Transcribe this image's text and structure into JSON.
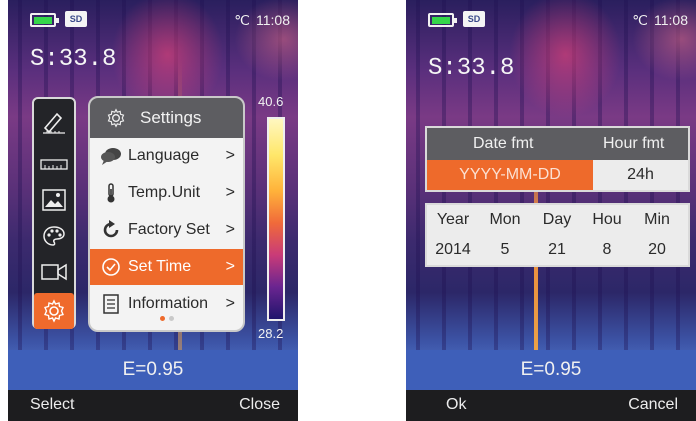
{
  "status": {
    "sd_label": "SD",
    "temp_unit": "℃",
    "time": "11:08"
  },
  "left_screen": {
    "spot": "S:33.8",
    "rail_icons": [
      "measure-pencil-icon",
      "ruler-icon",
      "image-gallery-icon",
      "palette-icon",
      "video-camera-icon",
      "gear-icon"
    ],
    "menu": {
      "title": "Settings",
      "items": [
        {
          "label": "Language",
          "arrow": ">",
          "icon": "speech-bubble-icon"
        },
        {
          "label": "Temp.Unit",
          "arrow": ">",
          "icon": "thermometer-icon"
        },
        {
          "label": "Factory Set",
          "arrow": ">",
          "icon": "reset-arrow-icon"
        },
        {
          "label": "Set Time",
          "arrow": ">",
          "icon": "clock-icon",
          "selected": true
        },
        {
          "label": "Information",
          "arrow": ">",
          "icon": "document-icon"
        }
      ],
      "page_index": 1,
      "page_count": 2
    },
    "scale": {
      "max": "40.6",
      "min": "28.2"
    },
    "emissivity": "E=0.95",
    "softkey_left": "Select",
    "softkey_right": "Close"
  },
  "right_screen": {
    "spot": "S:33.8",
    "date_fmt_header": "Date fmt",
    "hour_fmt_header": "Hour fmt",
    "date_fmt_value": "YYYY-MM-DD",
    "hour_fmt_value": "24h",
    "time_headers": [
      "Year",
      "Mon",
      "Day",
      "Hou",
      "Min"
    ],
    "time_values": [
      "2014",
      "5",
      "21",
      "8",
      "20"
    ],
    "emissivity": "E=0.95",
    "softkey_left": "Ok",
    "softkey_right": "Cancel"
  },
  "colors": {
    "accent_orange": "#ee6a2b",
    "header_gray": "#5d5d61",
    "bottom_blue": "#3e5fb9"
  }
}
